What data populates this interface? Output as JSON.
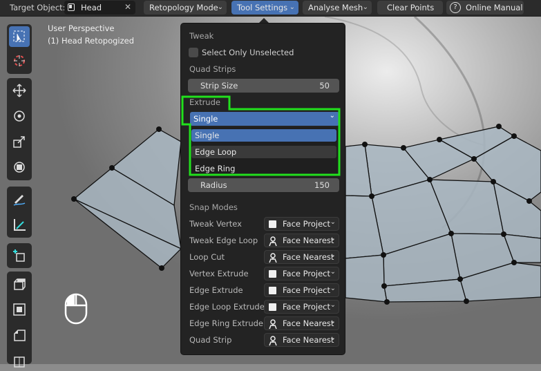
{
  "header": {
    "target_label": "Target Object:",
    "target_value": "Head",
    "retopology_mode": "Retopology Mode",
    "tool_settings": "Tool Settings",
    "analyse_mesh": "Analyse Mesh",
    "clear_points": "Clear Points",
    "online_manual": "Online Manual",
    "help_glyph": "?"
  },
  "viewport": {
    "perspective": "User Perspective",
    "object": "(1) Head Retopogized"
  },
  "panel": {
    "tweak_heading": "Tweak",
    "select_only_unselected": "Select Only Unselected",
    "quad_strips_heading": "Quad Strips",
    "strip_size_label": "Strip Size",
    "strip_size_value": "50",
    "extrude_heading": "Extrude",
    "extrude_selected": "Single",
    "extrude_options": [
      "Single",
      "Edge Loop",
      "Edge Ring"
    ],
    "radius_label": "Radius",
    "radius_value": "150",
    "snap_heading": "Snap Modes",
    "snap_rows": [
      {
        "label": "Tweak Vertex",
        "value": "Face Project",
        "icon": "square-icon"
      },
      {
        "label": "Tweak Edge Loop",
        "value": "Face Nearest",
        "icon": "snap-nearest-icon"
      },
      {
        "label": "Loop Cut",
        "value": "Face Nearest",
        "icon": "snap-nearest-icon"
      },
      {
        "label": "Vertex Extrude",
        "value": "Face Project",
        "icon": "square-icon"
      },
      {
        "label": "Edge Extrude",
        "value": "Face Project",
        "icon": "square-icon"
      },
      {
        "label": "Edge Loop Extrude",
        "value": "Face Project",
        "icon": "square-icon"
      },
      {
        "label": "Edge Ring Extrude",
        "value": "Face Nearest",
        "icon": "snap-nearest-icon"
      },
      {
        "label": "Quad Strip",
        "value": "Face Nearest",
        "icon": "snap-nearest-icon"
      }
    ]
  },
  "colors": {
    "accent": "#4772b3",
    "highlight_outline": "#22e01d",
    "panel_bg": "#232323",
    "header_bg": "#2b2b2b"
  }
}
